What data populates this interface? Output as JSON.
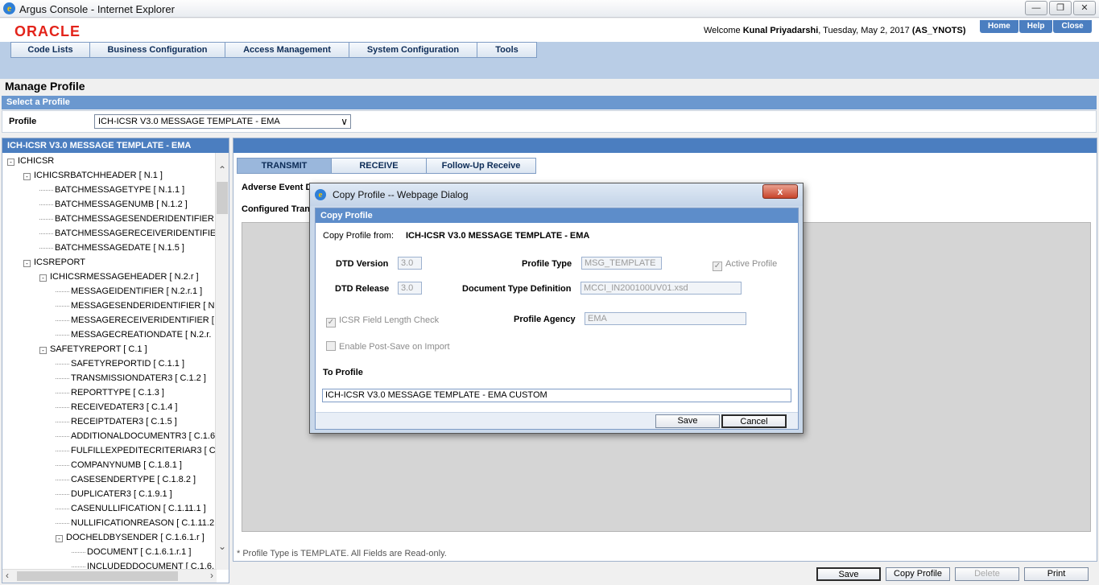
{
  "window": {
    "title": "Argus Console - Internet Explorer",
    "icon": "ie-icon",
    "controls": [
      "minimize",
      "maximize",
      "close"
    ]
  },
  "header": {
    "logo": "ORACLE",
    "welcome_prefix": "Welcome",
    "user_name": "Kunal Priyadarshi",
    "date_text": ", Tuesday, May 2, 2017",
    "instance": "(AS_YNOTS)",
    "links": [
      "Home",
      "Help",
      "Close"
    ]
  },
  "menu": [
    "Code Lists",
    "Business Configuration",
    "Access Management",
    "System Configuration",
    "Tools"
  ],
  "page": {
    "title": "Manage Profile",
    "section": "Select a Profile",
    "profile_label": "Profile",
    "profile_value": "ICH-ICSR V3.0 MESSAGE TEMPLATE - EMA"
  },
  "tree": {
    "header": "ICH-ICSR V3.0 MESSAGE TEMPLATE - EMA",
    "nodes": [
      {
        "label": "ICHICSR",
        "toggle": "-"
      },
      {
        "label": "ICHICSRBATCHHEADER [ N.1 ]",
        "toggle": "-"
      },
      {
        "label": "BATCHMESSAGETYPE [ N.1.1 ]",
        "toggle": ""
      },
      {
        "label": "BATCHMESSAGENUMB [ N.1.2 ]",
        "toggle": ""
      },
      {
        "label": "BATCHMESSAGESENDERIDENTIFIER",
        "toggle": ""
      },
      {
        "label": "BATCHMESSAGERECEIVERIDENTIFIE",
        "toggle": ""
      },
      {
        "label": "BATCHMESSAGEDATE [ N.1.5 ]",
        "toggle": ""
      },
      {
        "label": "ICSREPORT",
        "toggle": "-"
      },
      {
        "label": "ICHICSRMESSAGEHEADER [ N.2.r ]",
        "toggle": "-"
      },
      {
        "label": "MESSAGEIDENTIFIER [ N.2.r.1 ]",
        "toggle": ""
      },
      {
        "label": "MESSAGESENDERIDENTIFIER [ N",
        "toggle": ""
      },
      {
        "label": "MESSAGERECEIVERIDENTIFIER [",
        "toggle": ""
      },
      {
        "label": "MESSAGECREATIONDATE [ N.2.r.",
        "toggle": ""
      },
      {
        "label": "SAFETYREPORT [ C.1 ]",
        "toggle": "-"
      },
      {
        "label": "SAFETYREPORTID [ C.1.1 ]",
        "toggle": ""
      },
      {
        "label": "TRANSMISSIONDATER3 [ C.1.2 ]",
        "toggle": ""
      },
      {
        "label": "REPORTTYPE [ C.1.3 ]",
        "toggle": ""
      },
      {
        "label": "RECEIVEDATER3 [ C.1.4 ]",
        "toggle": ""
      },
      {
        "label": "RECEIPTDATER3 [ C.1.5 ]",
        "toggle": ""
      },
      {
        "label": "ADDITIONALDOCUMENTR3 [ C.1.6",
        "toggle": ""
      },
      {
        "label": "FULFILLEXPEDITECRITERIAR3 [ C",
        "toggle": ""
      },
      {
        "label": "COMPANYNUMB [ C.1.8.1 ]",
        "toggle": ""
      },
      {
        "label": "CASESENDERTYPE [ C.1.8.2 ]",
        "toggle": ""
      },
      {
        "label": "DUPLICATER3 [ C.1.9.1 ]",
        "toggle": ""
      },
      {
        "label": "CASENULLIFICATION [ C.1.11.1 ]",
        "toggle": ""
      },
      {
        "label": "NULLIFICATIONREASON [ C.1.11.2",
        "toggle": ""
      },
      {
        "label": "DOCHELDBYSENDER [ C.1.6.1.r ]",
        "toggle": "-"
      },
      {
        "label": "DOCUMENT [ C.1.6.1.r.1 ]",
        "toggle": ""
      },
      {
        "label": "INCLUDEDDOCUMENT [ C.1.6.1",
        "toggle": ""
      }
    ]
  },
  "tabs": [
    "TRANSMIT",
    "RECEIVE",
    "Follow-Up Receive"
  ],
  "active_tab": "TRANSMIT",
  "right_panel": {
    "adverse_label": "Adverse Event D",
    "configured_label": "Configured Tran",
    "footnote": "* Profile Type is TEMPLATE. All Fields are Read-only."
  },
  "bottom_buttons": [
    {
      "label": "Save",
      "enabled": true
    },
    {
      "label": "Copy Profile",
      "enabled": true
    },
    {
      "label": "Delete",
      "enabled": false
    },
    {
      "label": "Print",
      "enabled": true
    }
  ],
  "dialog": {
    "title": "Copy Profile -- Webpage Dialog",
    "close_glyph": "x",
    "section": "Copy Profile",
    "copy_from_label": "Copy Profile from:",
    "copy_from_value": "ICH-ICSR V3.0 MESSAGE TEMPLATE - EMA",
    "dtd_version_label": "DTD Version",
    "dtd_version_value": "3.0",
    "dtd_release_label": "DTD Release",
    "dtd_release_value": "3.0",
    "profile_type_label": "Profile Type",
    "profile_type_value": "MSG_TEMPLATE",
    "doc_type_label": "Document Type Definition",
    "doc_type_value": "MCCI_IN200100UV01.xsd",
    "active_profile_label": "Active Profile",
    "active_profile_checked": true,
    "icsr_check_label": "ICSR Field Length Check",
    "icsr_check_checked": true,
    "post_save_label": "Enable Post-Save on Import",
    "post_save_checked": false,
    "profile_agency_label": "Profile Agency",
    "profile_agency_value": "EMA",
    "to_profile_label": "To Profile",
    "to_profile_value": "ICH-ICSR V3.0 MESSAGE TEMPLATE - EMA CUSTOM",
    "save_label": "Save",
    "cancel_label": "Cancel"
  }
}
